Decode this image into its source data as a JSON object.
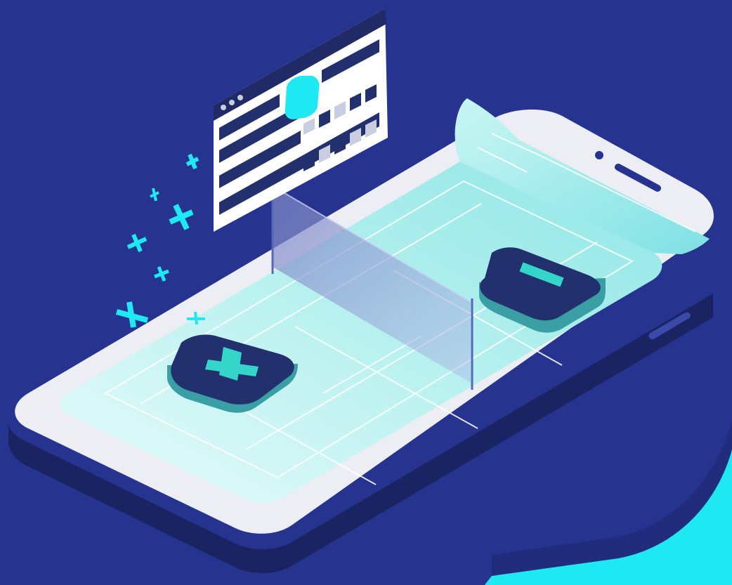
{
  "colors": {
    "background": "#27348f",
    "accent_cyan": "#1ee8f2",
    "phone_body": "#eceef3",
    "phone_edge": "#1e275f",
    "screen_glow": "#bff5f4",
    "button_navy": "#22306e",
    "button_glyph": "#34d6c9",
    "court_lines": "#ffffff"
  },
  "icons": {
    "plus_button": "plus-icon",
    "minus_button": "minus-icon",
    "sparkles": "plus-sparkle-icon",
    "browser_dots": "window-dots-icon"
  }
}
